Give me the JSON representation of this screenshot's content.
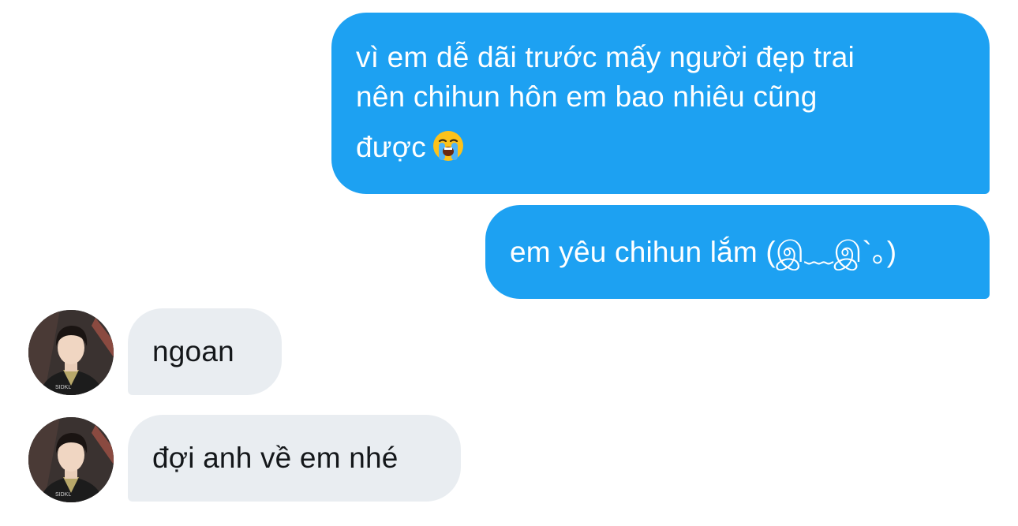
{
  "conversation": {
    "messages": [
      {
        "sender": "me",
        "lines": [
          "vì em dễ dãi trước mấy người đẹp trai",
          "nên chihun hôn em bao nhiêu cũng",
          "được"
        ],
        "emoji": "loudly-crying-face-icon"
      },
      {
        "sender": "me",
        "text": "em yêu chihun lắm (இ﹏இ`｡)"
      },
      {
        "sender": "other",
        "text": "ngoan"
      },
      {
        "sender": "other",
        "text": "đợi anh về em nhé"
      }
    ]
  },
  "colors": {
    "sent_bubble": "#1da1f2",
    "received_bubble": "#e9edf1",
    "sent_text": "#ffffff",
    "received_text": "#14171a"
  }
}
